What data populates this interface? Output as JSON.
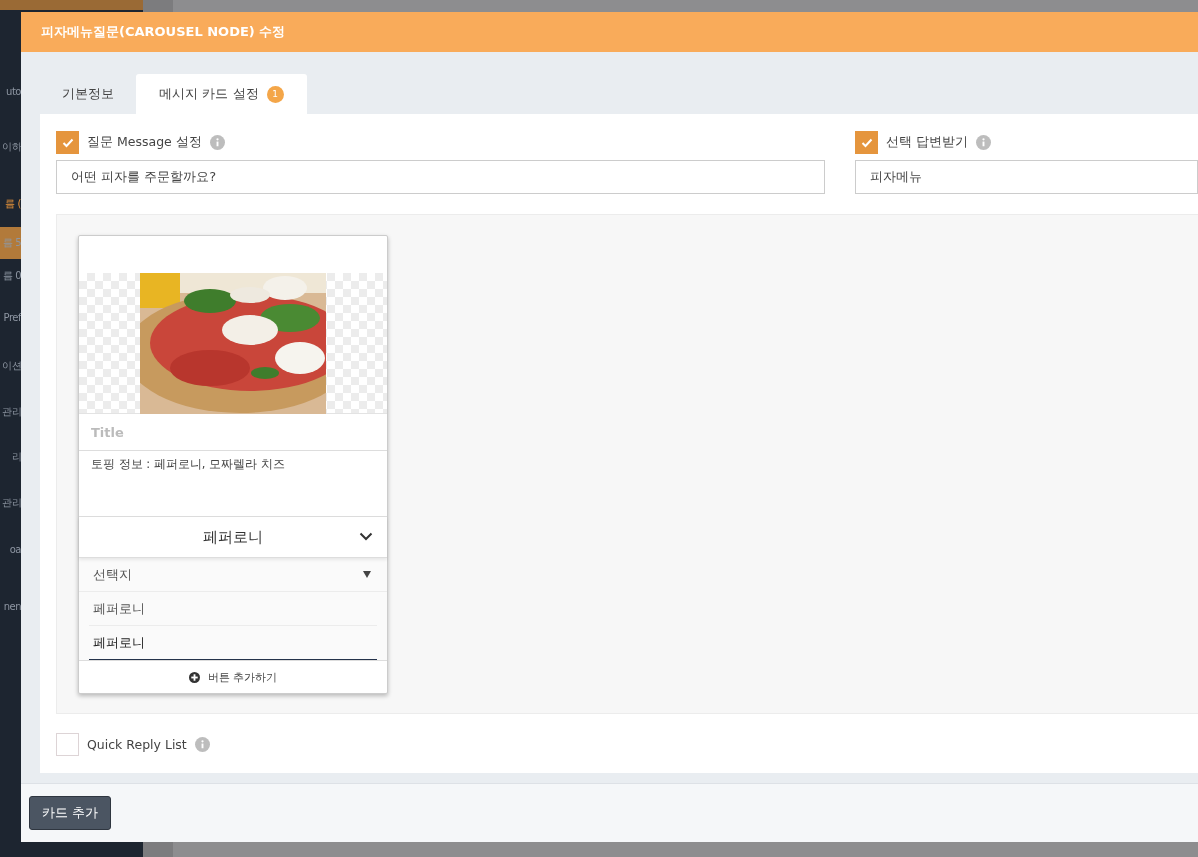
{
  "sidebar": {
    "items": [
      {
        "label": "uto",
        "selected": false,
        "expanded": false
      },
      {
        "label": "이하",
        "selected": false,
        "expanded": false
      },
      {
        "label": "름 (",
        "selected": false,
        "expanded": true
      },
      {
        "label": "름 5",
        "selected": true,
        "expanded": false
      },
      {
        "label": "름 0",
        "selected": false,
        "expanded": false
      },
      {
        "label": "Pref",
        "selected": false,
        "expanded": false
      },
      {
        "label": "이션",
        "selected": false,
        "expanded": false
      },
      {
        "label": "관리",
        "selected": false,
        "expanded": false
      },
      {
        "label": "리",
        "selected": false,
        "expanded": false
      },
      {
        "label": "관리",
        "selected": false,
        "expanded": false
      },
      {
        "label": "oa",
        "selected": false,
        "expanded": false
      },
      {
        "label": "nen",
        "selected": false,
        "expanded": false
      }
    ]
  },
  "dialog": {
    "title": "피자메뉴질문(CAROUSEL NODE) 수정"
  },
  "tabs": [
    {
      "label": "기본정보",
      "selected": false
    },
    {
      "label": "메시지 카드 설정",
      "selected": true,
      "badge": "1"
    }
  ],
  "options": [
    {
      "label": "질문 Message 설정",
      "checked": true,
      "value": "어떤 피자를 주문할까요?"
    },
    {
      "label": "선택 답변받기",
      "checked": true,
      "value": "피자메뉴"
    }
  ],
  "cards": [
    {
      "title_placeholder": "Title",
      "description": "토핑 정보 : 페퍼로니, 모짜렐라 치즈",
      "buttons": [
        {
          "label": "페퍼로니",
          "expanded": true,
          "type": "선택지",
          "label_value": "페퍼로니",
          "value": "페퍼로니"
        }
      ],
      "add_button": "버튼 추가하기"
    }
  ],
  "quick_reply": {
    "label": "Quick Reply List",
    "checked": false
  },
  "footer": {
    "add_card": "카드 추가"
  }
}
